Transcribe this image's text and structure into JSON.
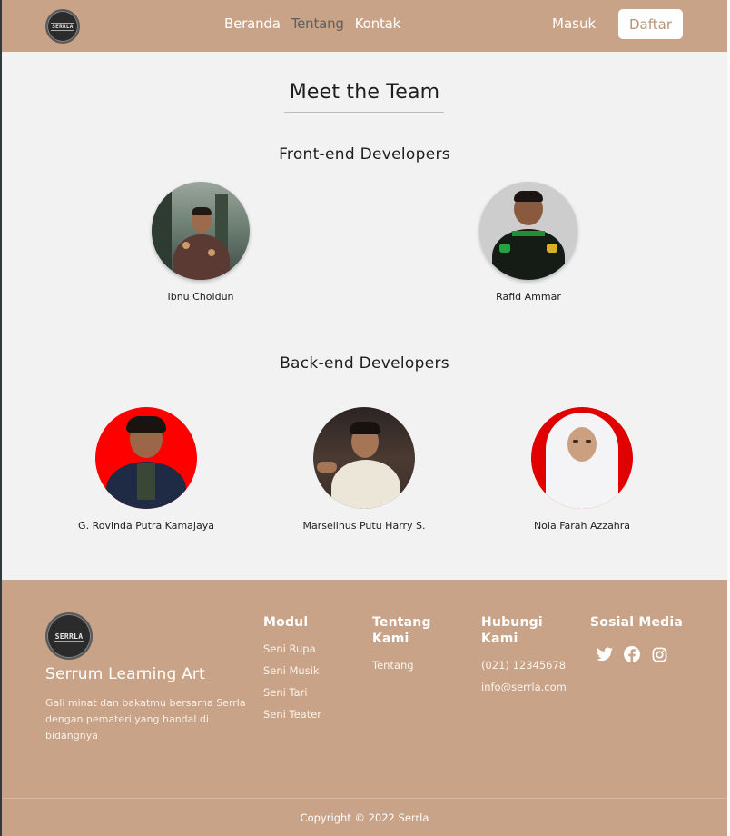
{
  "nav": {
    "brand": "SERRLA",
    "links": [
      "Beranda",
      "Tentang",
      "Kontak"
    ],
    "active": "Tentang",
    "login": "Masuk",
    "register": "Daftar"
  },
  "main": {
    "title": "Meet the Team",
    "frontend_title": "Front-end Developers",
    "backend_title": "Back-end Developers",
    "frontend": [
      {
        "name": "Ibnu Choldun"
      },
      {
        "name": "Rafid Ammar"
      }
    ],
    "backend": [
      {
        "name": "G. Rovinda Putra Kamajaya"
      },
      {
        "name": "Marselinus Putu Harry S."
      },
      {
        "name": "Nola Farah Azzahra"
      }
    ]
  },
  "footer": {
    "logo_text": "SERRLA",
    "brand": "Serrum Learning Art",
    "tagline": "Gali minat dan bakatmu bersama Serrla dengan pemateri yang handal di bidangnya",
    "modul": {
      "title": "Modul",
      "items": [
        "Seni Rupa",
        "Seni Musik",
        "Seni Tari",
        "Seni Teater"
      ]
    },
    "tentang": {
      "title": "Tentang Kami",
      "items": [
        "Tentang"
      ]
    },
    "hubungi": {
      "title": "Hubungi Kami",
      "items": [
        "(021) 12345678",
        "info@serrla.com"
      ]
    },
    "sosial": {
      "title": "Sosial Media",
      "icons": [
        "twitter-icon",
        "facebook-icon",
        "instagram-icon"
      ]
    },
    "copyright": "Copyright © 2022 Serrla"
  },
  "colors": {
    "brand_tan": "#c8a387",
    "page_bg": "#f2f2f2",
    "photo_red": "#ff0000"
  }
}
